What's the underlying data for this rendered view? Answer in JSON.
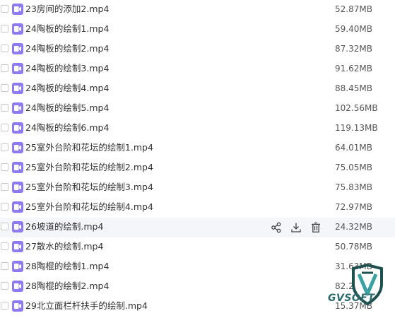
{
  "files": [
    {
      "name": "23房间的添加2.mp4",
      "size": "52.87MB"
    },
    {
      "name": "24陶板的绘制1.mp4",
      "size": "59.40MB"
    },
    {
      "name": "24陶板的绘制2.mp4",
      "size": "87.32MB"
    },
    {
      "name": "24陶板的绘制3.mp4",
      "size": "91.62MB"
    },
    {
      "name": "24陶板的绘制4.mp4",
      "size": "88.45MB"
    },
    {
      "name": "24陶板的绘制5.mp4",
      "size": "102.56MB"
    },
    {
      "name": "24陶板的绘制6.mp4",
      "size": "119.13MB"
    },
    {
      "name": "25室外台阶和花坛的绘制1.mp4",
      "size": "64.01MB"
    },
    {
      "name": "25室外台阶和花坛的绘制2.mp4",
      "size": "75.05MB"
    },
    {
      "name": "25室外台阶和花坛的绘制3.mp4",
      "size": "75.83MB"
    },
    {
      "name": "25室外台阶和花坛的绘制4.mp4",
      "size": "72.97MB"
    },
    {
      "name": "26坡道的绘制.mp4",
      "size": "24.32MB"
    },
    {
      "name": "27散水的绘制.mp4",
      "size": "50.78MB"
    },
    {
      "name": "28陶棍的绘制1.mp4",
      "size": "31.63MB"
    },
    {
      "name": "28陶棍的绘制2.mp4",
      "size": "82.2"
    },
    {
      "name": "29北立面栏杆扶手的绘制.mp4",
      "size": "15.37MB"
    }
  ],
  "hover_row_index": 11,
  "row_actions": [
    "share-icon",
    "download-icon",
    "delete-icon"
  ],
  "watermark": {
    "text": "GVSOFT"
  },
  "colors": {
    "file_icon": "#8d7bef",
    "hover_bg": "#f5f6fa",
    "watermark": "#2a6a6a"
  }
}
